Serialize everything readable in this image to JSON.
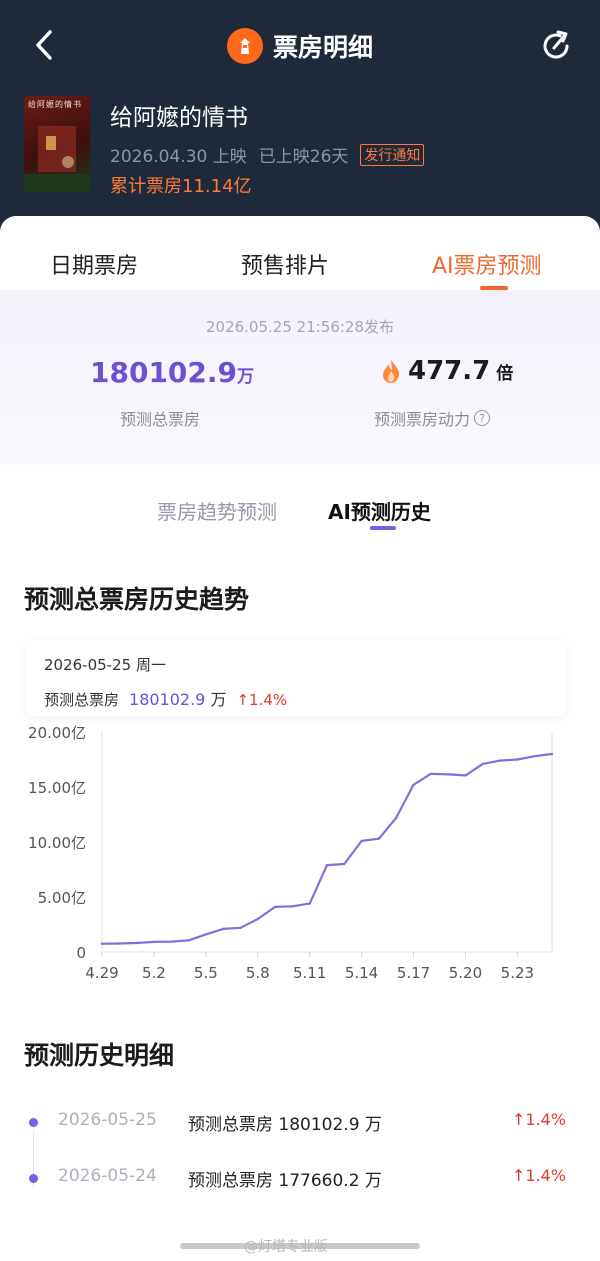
{
  "nav": {
    "title": "票房明细"
  },
  "movie": {
    "name": "给阿嬷的情书",
    "release": "2026.04.30 上映",
    "days": "已上映26天",
    "notice": "发行通知",
    "total_box": "累计票房11.14亿",
    "poster_title": "给阿嬷的情书"
  },
  "tabs": [
    {
      "label": "日期票房"
    },
    {
      "label": "预售排片"
    },
    {
      "label": "AI票房预测"
    }
  ],
  "prediction": {
    "published": "2026.05.25 21:56:28发布",
    "total_value": "180102.9",
    "total_unit": "万",
    "total_label": "预测总票房",
    "power_value": "477.7",
    "power_unit": "倍",
    "power_label": "预测票房动力",
    "help_icon": "question-icon"
  },
  "subtabs": [
    {
      "label": "票房趋势预测"
    },
    {
      "label": "AI预测历史"
    }
  ],
  "trend": {
    "title": "预测总票房历史趋势",
    "tooltip": {
      "date": "2026-05-25  周一",
      "label": "预测总票房",
      "value": "180102.9",
      "unit": "万",
      "change": "↑1.4%"
    }
  },
  "chart_data": {
    "type": "line",
    "color": "#8a6ae0",
    "x": [
      "4.29",
      "4.30",
      "5.1",
      "5.2",
      "5.3",
      "5.4",
      "5.5",
      "5.6",
      "5.7",
      "5.8",
      "5.9",
      "5.10",
      "5.11",
      "5.12",
      "5.13",
      "5.14",
      "5.15",
      "5.16",
      "5.17",
      "5.18",
      "5.19",
      "5.20",
      "5.21",
      "5.22",
      "5.23",
      "5.24",
      "5.25"
    ],
    "values": [
      0.75,
      0.77,
      0.82,
      0.92,
      0.95,
      1.05,
      1.6,
      2.1,
      2.2,
      3.0,
      4.1,
      4.15,
      4.4,
      7.9,
      8.0,
      10.1,
      10.3,
      12.2,
      15.2,
      16.2,
      16.15,
      16.05,
      17.1,
      17.4,
      17.5,
      17.8,
      18.0
    ],
    "x_ticks": [
      "4.29",
      "5.2",
      "5.5",
      "5.8",
      "5.11",
      "5.14",
      "5.17",
      "5.20",
      "5.23"
    ],
    "y_ticks": [
      "0",
      "5.00亿",
      "10.00亿",
      "15.00亿",
      "20.00亿"
    ],
    "ylim": [
      0,
      20
    ],
    "grid": false
  },
  "history": {
    "title": "预测历史明细",
    "items": [
      {
        "date": "2026-05-25",
        "label": "预测总票房 180102.9 万",
        "change": "↑1.4%"
      },
      {
        "date": "2026-05-24",
        "label": "预测总票房 177660.2 万",
        "change": "↑1.4%"
      }
    ]
  },
  "watermark": "@灯塔专业版"
}
